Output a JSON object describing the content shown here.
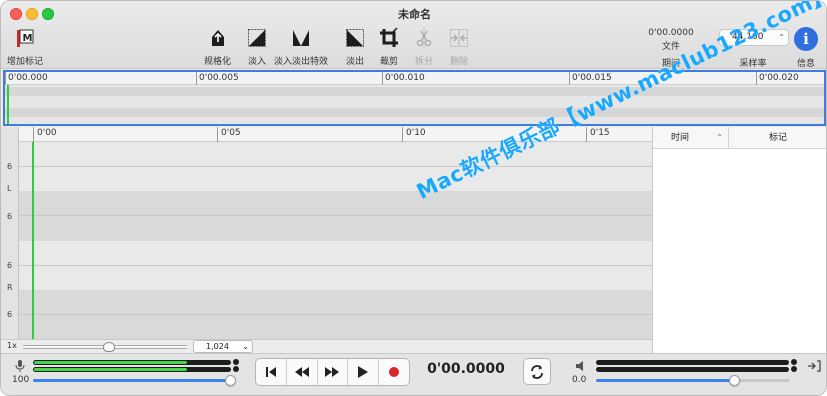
{
  "window": {
    "title": "未命名"
  },
  "toolbar": {
    "add_marker": "增加标记",
    "normalize": "规格化",
    "fade_in": "淡入",
    "crossfade": "淡入淡出特效",
    "fade_out": "淡出",
    "crop": "裁剪",
    "split": "拆分",
    "delete": "删除",
    "timecode_value": "0'00.0000",
    "timecode_sub": "文件",
    "period_label": "期间",
    "sample_rate_value": "44,100",
    "sample_rate_label": "采样率",
    "info_label": "信息"
  },
  "overview": {
    "ticks": [
      "0'00.000",
      "0'00.005",
      "0'00.010",
      "0'00.015",
      "0'00.020"
    ]
  },
  "ruler": {
    "ticks": [
      "0'00",
      "0'05",
      "0'10",
      "0'15"
    ]
  },
  "channels": {
    "g1": "6",
    "l": "L",
    "g2": "6",
    "g3": "6",
    "r": "R",
    "g4": "6"
  },
  "zoom": {
    "label": "1x",
    "value": "1,024"
  },
  "markers": {
    "col_time": "时间",
    "col_marker": "标记"
  },
  "transport": {
    "input_volume": "100",
    "input_level_left": 0.78,
    "input_level_right": 0.78,
    "input_slider": 1.0,
    "timecode": "0'00.0000",
    "output_volume": "0.0",
    "output_slider": 0.72
  },
  "watermark": "Mac软件俱乐部【www.maclub123.com】",
  "colors": {
    "accent": "#3f7be0",
    "cursor": "#2ecb3a",
    "meter": "#46d64b",
    "record": "#d9262b",
    "info": "#2f6fe0"
  }
}
